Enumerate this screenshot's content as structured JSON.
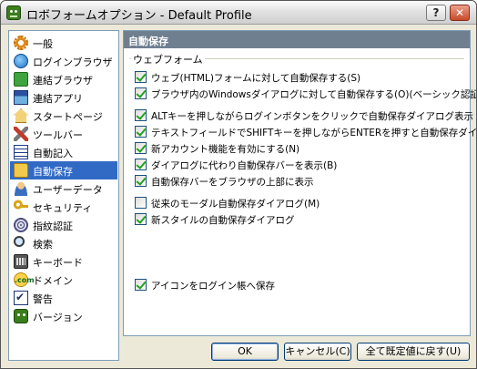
{
  "window": {
    "title": "ロボフォームオプション - Default Profile",
    "help_label": "?",
    "close_label": "✕"
  },
  "nav": {
    "selected_color": "#316ac5",
    "items": [
      {
        "label": "一般",
        "icon": "gear-icon"
      },
      {
        "label": "ログインブラウザ",
        "icon": "globe-icon"
      },
      {
        "label": "連結ブラウザ",
        "icon": "puzzle-icon"
      },
      {
        "label": "連結アプリ",
        "icon": "app-icon"
      },
      {
        "label": "スタートページ",
        "icon": "house-icon"
      },
      {
        "label": "ツールバー",
        "icon": "tools-icon"
      },
      {
        "label": "自動記入",
        "icon": "form-icon"
      },
      {
        "label": "自動保存",
        "icon": "folder-icon",
        "selected": true
      },
      {
        "label": "ユーザーデータ",
        "icon": "user-icon"
      },
      {
        "label": "セキュリティ",
        "icon": "key-icon"
      },
      {
        "label": "指紋認証",
        "icon": "fingerprint-icon"
      },
      {
        "label": "検索",
        "icon": "magnifier-icon"
      },
      {
        "label": "キーボード",
        "icon": "keyboard-icon"
      },
      {
        "label": "ドメイン",
        "icon": "dotcom-icon"
      },
      {
        "label": "警告",
        "icon": "checkmark-icon"
      },
      {
        "label": "バージョン",
        "icon": "robo-icon"
      }
    ]
  },
  "panel": {
    "header": "自動保存",
    "header_color": "#6f7f8f",
    "group_label": "ウェブフォーム",
    "options": [
      {
        "label": "ウェブ(HTML)フォームに対して自動保存する(S)",
        "checked": true
      },
      {
        "label": "ブラウザ内のWindowsダイアログに対して自動保存する(O)(ベーシック認証)",
        "checked": true
      },
      {
        "label": "ALTキーを押しながらログインボタンをクリックで自動保存ダイアログ表示",
        "checked": true
      },
      {
        "label": "テキストフィールドでSHIFTキーを押しながらENTERを押すと自動保存ダイアログ表:",
        "checked": true
      },
      {
        "label": "新アカウント機能を有効にする(N)",
        "checked": true
      },
      {
        "label": "ダイアログに代わり自動保存バーを表示(B)",
        "checked": true
      },
      {
        "label": "自動保存バーをブラウザの上部に表示",
        "checked": true
      },
      {
        "label": "従来のモーダル自動保存ダイアログ(M)",
        "checked": false
      },
      {
        "label": "新スタイルの自動保存ダイアログ",
        "checked": true
      }
    ],
    "bottom_option": {
      "label": "アイコンをログイン帳へ保存",
      "checked": true
    }
  },
  "buttons": {
    "ok": "OK",
    "cancel": "キャンセル(C)",
    "reset": "全て既定値に戻す(U)"
  }
}
